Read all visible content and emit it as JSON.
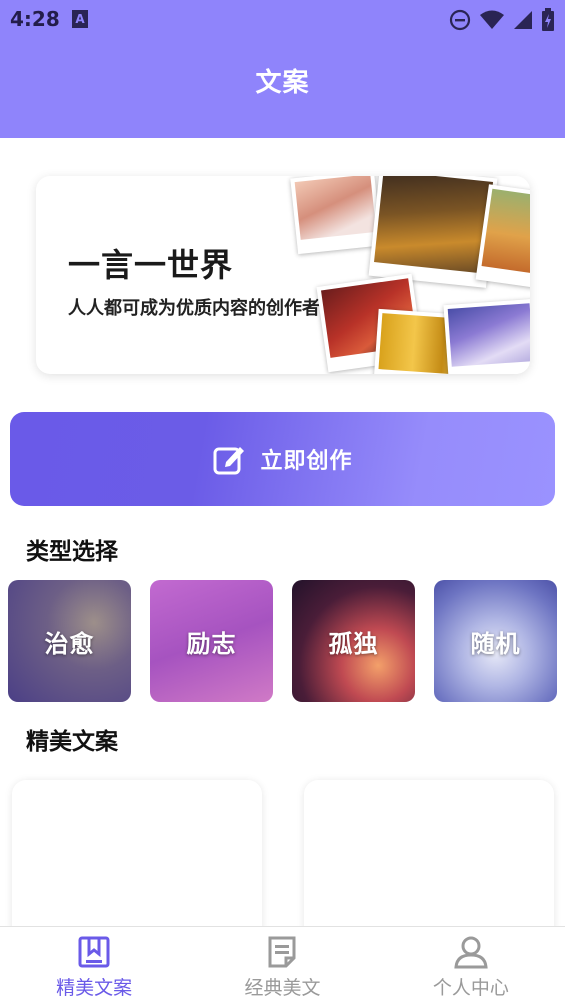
{
  "status_bar": {
    "time": "4:28",
    "notification_icon_letter": "A"
  },
  "header": {
    "title": "文案"
  },
  "banner": {
    "title": "一言一世界",
    "subtitle": "人人都可成为优质内容的创作者"
  },
  "create_button": {
    "label": "立即创作",
    "icon": "edit-icon"
  },
  "type_section": {
    "title": "类型选择",
    "items": [
      {
        "label": "治愈"
      },
      {
        "label": "励志"
      },
      {
        "label": "孤独"
      },
      {
        "label": "随机"
      }
    ]
  },
  "featured_section": {
    "title": "精美文案"
  },
  "bottom_nav": {
    "items": [
      {
        "label": "精美文案",
        "icon": "bookmark-book-icon",
        "active": true
      },
      {
        "label": "经典美文",
        "icon": "document-icon",
        "active": false
      },
      {
        "label": "个人中心",
        "icon": "user-icon",
        "active": false
      }
    ]
  },
  "colors": {
    "primary": "#8f84fb",
    "accent": "#6a5ae8",
    "inactive": "#9a9a9a"
  }
}
